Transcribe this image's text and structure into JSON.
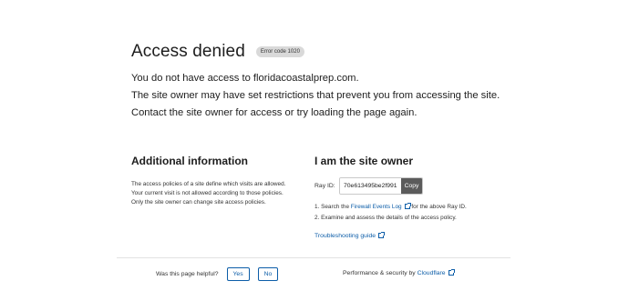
{
  "main": {
    "title": "Access denied",
    "error_badge": "Error code 1020",
    "lines": [
      "You do not have access to floridacoastalprep.com.",
      "The site owner may have set restrictions that prevent you from accessing the site.",
      "Contact the site owner for access or try loading the page again."
    ]
  },
  "additional": {
    "heading": "Additional information",
    "lines": [
      "The access policies of a site define which visits are allowed.",
      "Your current visit is not allowed according to those policies.",
      "Only the site owner can change site access policies."
    ]
  },
  "owner": {
    "heading": "I am the site owner",
    "ray_label": "Ray ID:",
    "ray_id": "70e613495be2f991",
    "copy_label": "Copy",
    "step1_prefix": "1. Search the ",
    "step1_link": "Firewall Events Log",
    "step1_suffix": " for the above Ray ID.",
    "step2": "2. Examine and assess the details of the access policy.",
    "troubleshooting": "Troubleshooting guide"
  },
  "footer": {
    "question": "Was this page helpful?",
    "yes": "Yes",
    "no": "No",
    "perf_prefix": "Performance & security by ",
    "cloudflare": "Cloudflare"
  },
  "colors": {
    "link": "#0c5da8",
    "copy_button": "#5b5b5b",
    "badge_bg": "#d9d9d9"
  }
}
